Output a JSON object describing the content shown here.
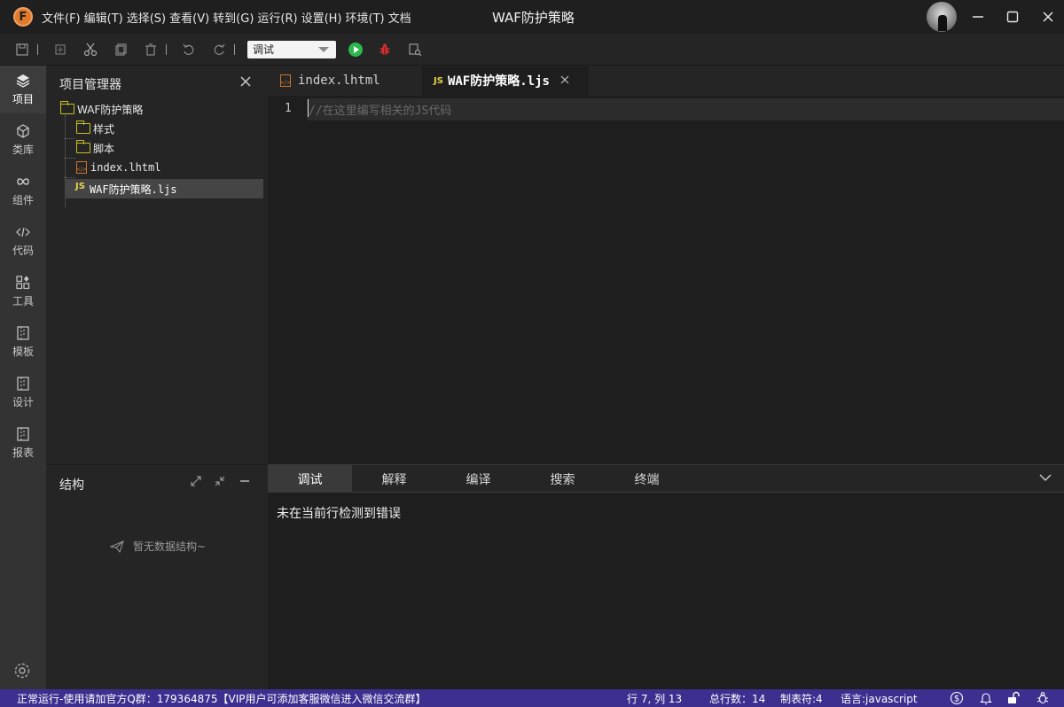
{
  "titlebar": {
    "logo_letter": "F",
    "menu": [
      "文件(F)",
      "编辑(T)",
      "选择(S)",
      "查看(V)",
      "转到(G)",
      "运行(R)",
      "设置(H)",
      "环境(T)",
      "文档"
    ],
    "window_title": "WAF防护策略",
    "minimize": "—",
    "maximize": "☐",
    "close": "✕"
  },
  "toolbar": {
    "mode_value": "调试"
  },
  "activity": {
    "items": [
      "项目",
      "类库",
      "组件",
      "代码",
      "工具",
      "模板",
      "设计",
      "报表"
    ]
  },
  "sidebar": {
    "title": "项目管理器",
    "close": "✕",
    "tree": {
      "root": "WAF防护策略",
      "children": [
        "样式",
        "脚本",
        "index.lhtml",
        "WAF防护策略.ljs"
      ],
      "js_badge": "JS",
      "html_badge": "</>"
    },
    "structure": {
      "title": "结构",
      "empty_text": "暂无数据结构~"
    }
  },
  "editor": {
    "tabs": [
      {
        "label": "index.lhtml",
        "active": false
      },
      {
        "label": "WAF防护策略.ljs",
        "active": true,
        "badge": "JS",
        "close": "✕"
      }
    ],
    "line_number": "1",
    "code": "//在这里编写相关的JS代码"
  },
  "panel": {
    "tabs": [
      "调试",
      "解释",
      "编译",
      "搜索",
      "终端"
    ],
    "active_tab": "调试",
    "message": "未在当前行检测到错误"
  },
  "statusbar": {
    "left": "正常运行-使用请加官方Q群：179364875【VIP用户可添加客服微信进入微信交流群】",
    "position": "行 7, 列 13",
    "total_lines": "总行数：14",
    "tab_size": "制表符:4",
    "language": "语言:javascript",
    "color": "#3b2f8f"
  }
}
